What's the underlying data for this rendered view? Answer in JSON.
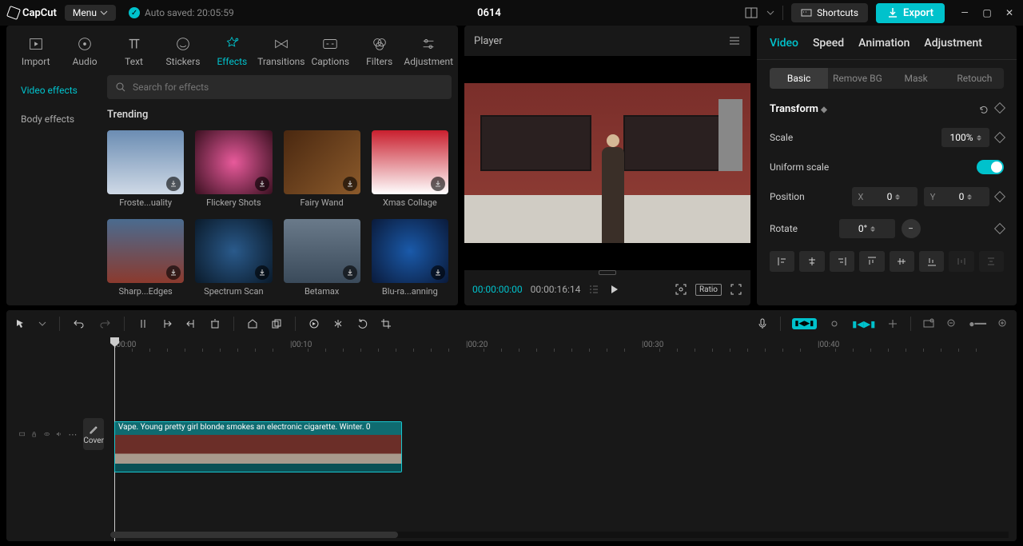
{
  "app_name": "CapCut",
  "menu_label": "Menu",
  "autosave_label": "Auto saved: 20:05:59",
  "project_title": "0614",
  "shortcuts_label": "Shortcuts",
  "export_label": "Export",
  "media_tabs": {
    "import": "Import",
    "audio": "Audio",
    "text": "Text",
    "stickers": "Stickers",
    "effects": "Effects",
    "transitions": "Transitions",
    "captions": "Captions",
    "filters": "Filters",
    "adjustment": "Adjustment"
  },
  "effects_subnav": {
    "video": "Video effects",
    "body": "Body effects"
  },
  "search_placeholder": "Search for effects",
  "trending_label": "Trending",
  "fx": [
    {
      "label": "Froste...uality"
    },
    {
      "label": "Flickery Shots"
    },
    {
      "label": "Fairy Wand"
    },
    {
      "label": "Xmas Collage"
    },
    {
      "label": "Sharp...Edges"
    },
    {
      "label": "Spectrum Scan"
    },
    {
      "label": "Betamax"
    },
    {
      "label": "Blu-ra...anning"
    }
  ],
  "player_label": "Player",
  "tc_current": "00:00:00:00",
  "tc_duration": "00:00:16:14",
  "ratio_label": "Ratio",
  "inspector_tabs": {
    "video": "Video",
    "speed": "Speed",
    "animation": "Animation",
    "adjustment": "Adjustment"
  },
  "inspector_subtabs": {
    "basic": "Basic",
    "removebg": "Remove BG",
    "mask": "Mask",
    "retouch": "Retouch"
  },
  "transform": {
    "title": "Transform",
    "scale_label": "Scale",
    "scale_value": "100%",
    "uniform_label": "Uniform scale",
    "position_label": "Position",
    "x": "0",
    "y": "0",
    "rotate_label": "Rotate",
    "rotate_value": "0°"
  },
  "ruler": [
    "00:00",
    "00:10",
    "00:20",
    "00:30",
    "00:40"
  ],
  "clip_title": "Vape. Young pretty girl blonde smokes an electronic cigarette. Winter.    0",
  "cover_label": "Cover"
}
